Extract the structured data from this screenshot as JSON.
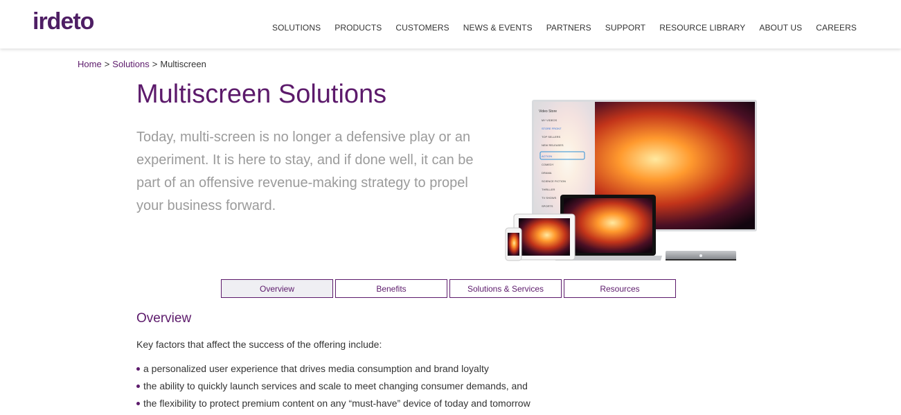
{
  "brand": {
    "logo_text": "irdeto",
    "primary_color": "#5c1a6b",
    "accent_color": "#4e1e64"
  },
  "nav": {
    "items": [
      "SOLUTIONS",
      "PRODUCTS",
      "CUSTOMERS",
      "NEWS & EVENTS",
      "PARTNERS",
      "SUPPORT",
      "RESOURCE LIBRARY",
      "ABOUT US",
      "CAREERS"
    ]
  },
  "breadcrumb": {
    "home": "Home",
    "sep": ">",
    "solutions": "Solutions",
    "current": "Multiscreen"
  },
  "page": {
    "title": "Multiscreen Solutions",
    "intro": "Today, multi-screen is no longer a defensive play or an experiment. It is here to stay, and if done well, it can be part of an offensive revenue-making strategy to propel your business forward."
  },
  "hero": {
    "menu_title": "Video Store",
    "menu_items": [
      "MY VIDEOS",
      "STORE FRONT",
      "TOP SELLERS",
      "NEW RELEASES",
      "ACTION",
      "COMEDY",
      "DRAMA",
      "SCIENCE FICTION",
      "THRILLER",
      "TV SHOWS",
      "SPORTS"
    ]
  },
  "tabs": [
    {
      "label": "Overview",
      "active": true
    },
    {
      "label": "Benefits",
      "active": false
    },
    {
      "label": "Solutions & Services",
      "active": false
    },
    {
      "label": "Resources",
      "active": false
    }
  ],
  "overview": {
    "title": "Overview",
    "lead": "Key factors that affect the success of the offering include:",
    "bullets": [
      "a personalized user experience that drives media consumption and brand loyalty",
      "the ability to quickly launch services and scale to meet changing consumer demands, and",
      "the flexibility to protect premium content on any “must-have” device of today and tomorrow"
    ]
  }
}
